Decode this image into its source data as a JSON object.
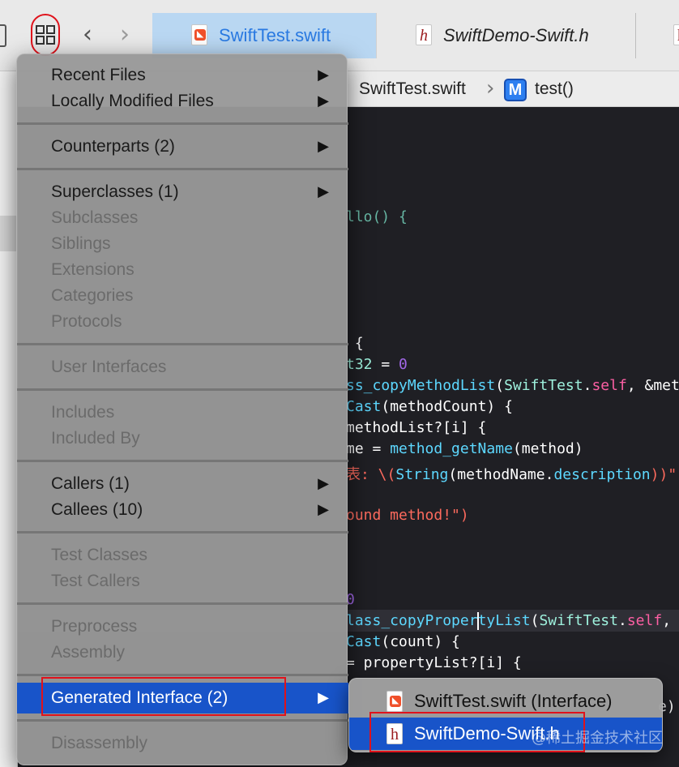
{
  "toolbar": {
    "tabs": [
      {
        "label": "SwiftTest.swift",
        "icon": "swift-file-icon",
        "active": true
      },
      {
        "label": "SwiftDemo-Swift.h",
        "icon": "header-file-icon",
        "active": false
      }
    ]
  },
  "jumpbar": {
    "file": "SwiftTest.swift",
    "method_badge": "M",
    "method": "test()"
  },
  "code": {
    "l1": "llo() {",
    "l2": " {",
    "l3a": "t32",
    "l3b": " = ",
    "l3c": "0",
    "l4a": "ss_copyMethodList",
    "l4b": "(",
    "l4c": "SwiftTest",
    "l4d": ".",
    "l4e": "self",
    "l4f": ", &met",
    "l5a": "Cast",
    "l5b": "(methodCount) {",
    "l6": "methodList?[i] {",
    "l7a": "me = ",
    "l7b": "method_getName",
    "l7c": "(method)",
    "l8a": "表: \\(",
    "l8b": "String",
    "l8c": "(methodName.",
    "l8d": "description",
    "l8e": "))\"",
    "l9": "ound method!\")",
    "l10": "0",
    "l11a": "lass_copyProper",
    "l11b": "tyList",
    "l11c": "(",
    "l11d": "SwiftTest",
    "l11e": ".",
    "l11f": "self",
    "l11g": ",",
    "l12a": "Cast",
    "l12b": "(count) {",
    "l13": "= propertyList?[i] {",
    "l14": "e)"
  },
  "menu": {
    "recent_files": "Recent Files",
    "locally_modified": "Locally Modified Files",
    "counterparts": "Counterparts (2)",
    "superclasses": "Superclasses (1)",
    "subclasses": "Subclasses",
    "siblings": "Siblings",
    "extensions": "Extensions",
    "categories": "Categories",
    "protocols": "Protocols",
    "user_interfaces": "User Interfaces",
    "includes": "Includes",
    "included_by": "Included By",
    "callers": "Callers (1)",
    "callees": "Callees (10)",
    "test_classes": "Test Classes",
    "test_callers": "Test Callers",
    "preprocess": "Preprocess",
    "assembly": "Assembly",
    "generated_interface": "Generated Interface (2)",
    "disassembly": "Disassembly",
    "arrow": "▶"
  },
  "submenu": {
    "items": [
      {
        "label": "SwiftTest.swift (Interface)",
        "icon": "swift-file-icon"
      },
      {
        "label": "SwiftDemo-Swift.h",
        "icon": "header-file-icon",
        "selected": true
      }
    ]
  },
  "watermark": "@稀土掘金技术社区",
  "colors": {
    "selection": "#1854c9",
    "annotation_red": "#e0121b",
    "active_tab": "#b9d7f2"
  }
}
